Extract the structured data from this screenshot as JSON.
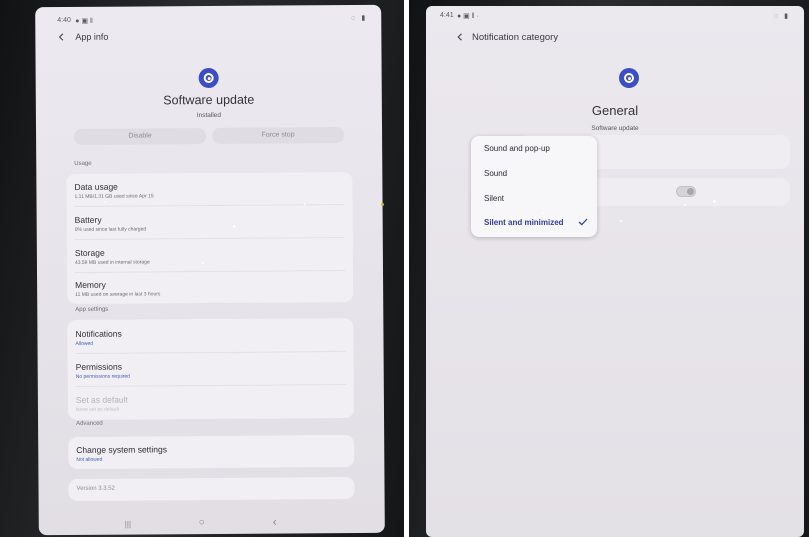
{
  "left": {
    "status": {
      "time": "4:40",
      "notif_icons": "● ▣ ‖",
      "sys_icons": "◌ ▮"
    },
    "appbar": {
      "title": "App info"
    },
    "app": {
      "name": "Software update",
      "status": "Installed"
    },
    "buttons": {
      "disable": "Disable",
      "force_stop": "Force stop"
    },
    "sections": {
      "usage": "Usage",
      "app_settings": "App settings",
      "advanced": "Advanced"
    },
    "usage_rows": [
      {
        "title": "Data usage",
        "sub": "1.11 MB/1.31 GB used since Apr 15"
      },
      {
        "title": "Battery",
        "sub": "0% used since last fully charged"
      },
      {
        "title": "Storage",
        "sub": "43.59 MB used in internal storage"
      },
      {
        "title": "Memory",
        "sub": "11 MB used on average in last 3 hours"
      }
    ],
    "app_settings_rows": [
      {
        "title": "Notifications",
        "sub": "Allowed"
      },
      {
        "title": "Permissions",
        "sub": "No permissions required"
      },
      {
        "title": "Set as default",
        "sub": "None set as default"
      }
    ],
    "advanced_rows": [
      {
        "title": "Change system settings",
        "sub": "Not allowed"
      }
    ],
    "version": "Version 3.3.52",
    "nav": {
      "recents": "|||",
      "home": "○",
      "back": "‹"
    }
  },
  "right": {
    "status": {
      "time": "4:41",
      "notif_icons": "● ▣ ‖ ·",
      "sys_icons": "◌ ▮"
    },
    "appbar": {
      "title": "Notification category"
    },
    "category": {
      "name": "General",
      "app": "Software update"
    },
    "popup_options": [
      "Sound and pop-up",
      "Sound",
      "Silent",
      "Silent and minimized"
    ],
    "selected_option": "Silent and minimized"
  },
  "colors": {
    "accent": "#3b4ec6",
    "selected_text": "#2f3f9e",
    "sub_blue": "#3e5bb9",
    "background": "#eceaf0"
  },
  "icons": {
    "app": "software-update-icon",
    "back": "chevron-left-icon",
    "check": "checkmark-icon",
    "toggle": "toggle-switch"
  }
}
